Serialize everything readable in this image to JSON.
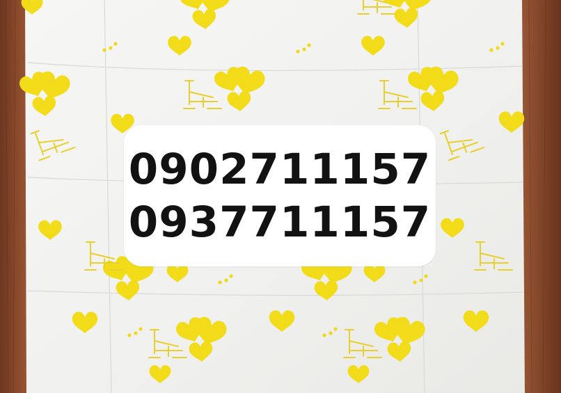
{
  "overlay": {
    "phone_numbers": [
      "0902711157",
      "0937711157"
    ]
  },
  "scene": {
    "background_color": "#8a4a2c",
    "paper_color": "#f4f4f2",
    "print_color": "#f2dc1a",
    "motif_icons": [
      "heart-balloon-icon",
      "bicycle-icon",
      "heart-icon"
    ]
  }
}
